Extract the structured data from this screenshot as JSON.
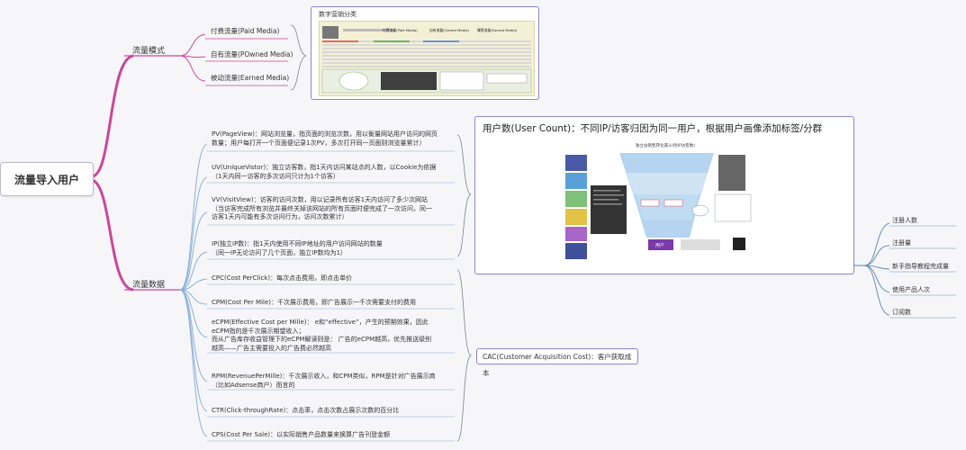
{
  "root": {
    "label": "流量导入用户"
  },
  "branches": {
    "traffic_mode": {
      "label": "流量模式",
      "children": [
        "付费流量(Paid Media)",
        "自有流量(POwned Media)",
        "被动流量(Earned Media)"
      ]
    },
    "traffic_data": {
      "label": "流量数据"
    }
  },
  "digital_box": {
    "title": "数字营销分类",
    "table_headers": [
      "付费流量(Paid Media)",
      "自有流量(Owned Media)",
      "赚得流量(Earned Media)"
    ]
  },
  "metrics": {
    "pv": [
      "PV(PageView)：网站浏览量，指页面的浏览次数，用以衡量网站用户访问的网页",
      "数量；用户每打开一个页面便记录1次PV，多次打开同一页面则浏览量累计）"
    ],
    "uv": [
      "UV(UniqueVistor)：独立访客数，指1天内访问某站点的人数，以Cookie为依据",
      "（1天内同一访客的多次访问只计为1个访客）"
    ],
    "vv": [
      "VV(VisitView)：访客的访问次数，用以记录所有访客1天内访问了多少次网站",
      "（当访客完成所有浏览并最终关掉该网站的所有页面时便完成了一次访问，同一",
      "访客1天内可能有多次访问行为，访问次数累计）"
    ],
    "ip": [
      "IP(独立IP数)：指1天内使用不同IP地址的用户访问网站的数量",
      "（同一IP无论访问了几个页面，独立IP数均为1）"
    ],
    "cpc": [
      "CPC(Cost PerClick)：每次点击费用，即点击单价"
    ],
    "cpm": [
      "CPM(Cost Per Mile)：千次展示费用，即广告展示一千次需要支付的费用"
    ],
    "ecpm": [
      "eCPM(Effective Cost per Mille)：  e和“effective”，产生的预期效果，因此",
      "eCPM指的是千次展示期望收入；",
      "而从广告库存收益管理下的eCPM解读则是：  广告的eCPM越高，优先推送级别",
      "越高——广告主需要投入的广告费必然越高"
    ],
    "rpm": [
      "RPM(RevenuePerMille)：千次展示收入，和CPM类似，RPM是针对广告展示商",
      "（比如Adsense商户）而言的"
    ],
    "ctr": [
      "CTR(Click-throughRate)：点击率，点击次数占展示次数的百分比"
    ],
    "cps": [
      "CPS(Cost Per Sale)：以实际销售产品数量来换算广告刊登金额"
    ]
  },
  "user_panel": {
    "heading": "用户数(User Count)：不同IP/访客归因为同一用户，根据用户画像添加标签/分群",
    "image_title": "独立站销售转化漏斗(附IP访客数)",
    "funnel_center": "用户"
  },
  "cac": {
    "label": "CAC(Customer Acquisition Cost)：客户获取成本"
  },
  "user_metrics": [
    "注册人数",
    "注册量",
    "新手指导教程完成量",
    "使用产品人次",
    "订阅数"
  ],
  "colors": {
    "branch_line": "#c9479c",
    "metric_line": "#8ab0d8",
    "box_border": "#8b84d9",
    "right_line": "#6d8fb3"
  }
}
